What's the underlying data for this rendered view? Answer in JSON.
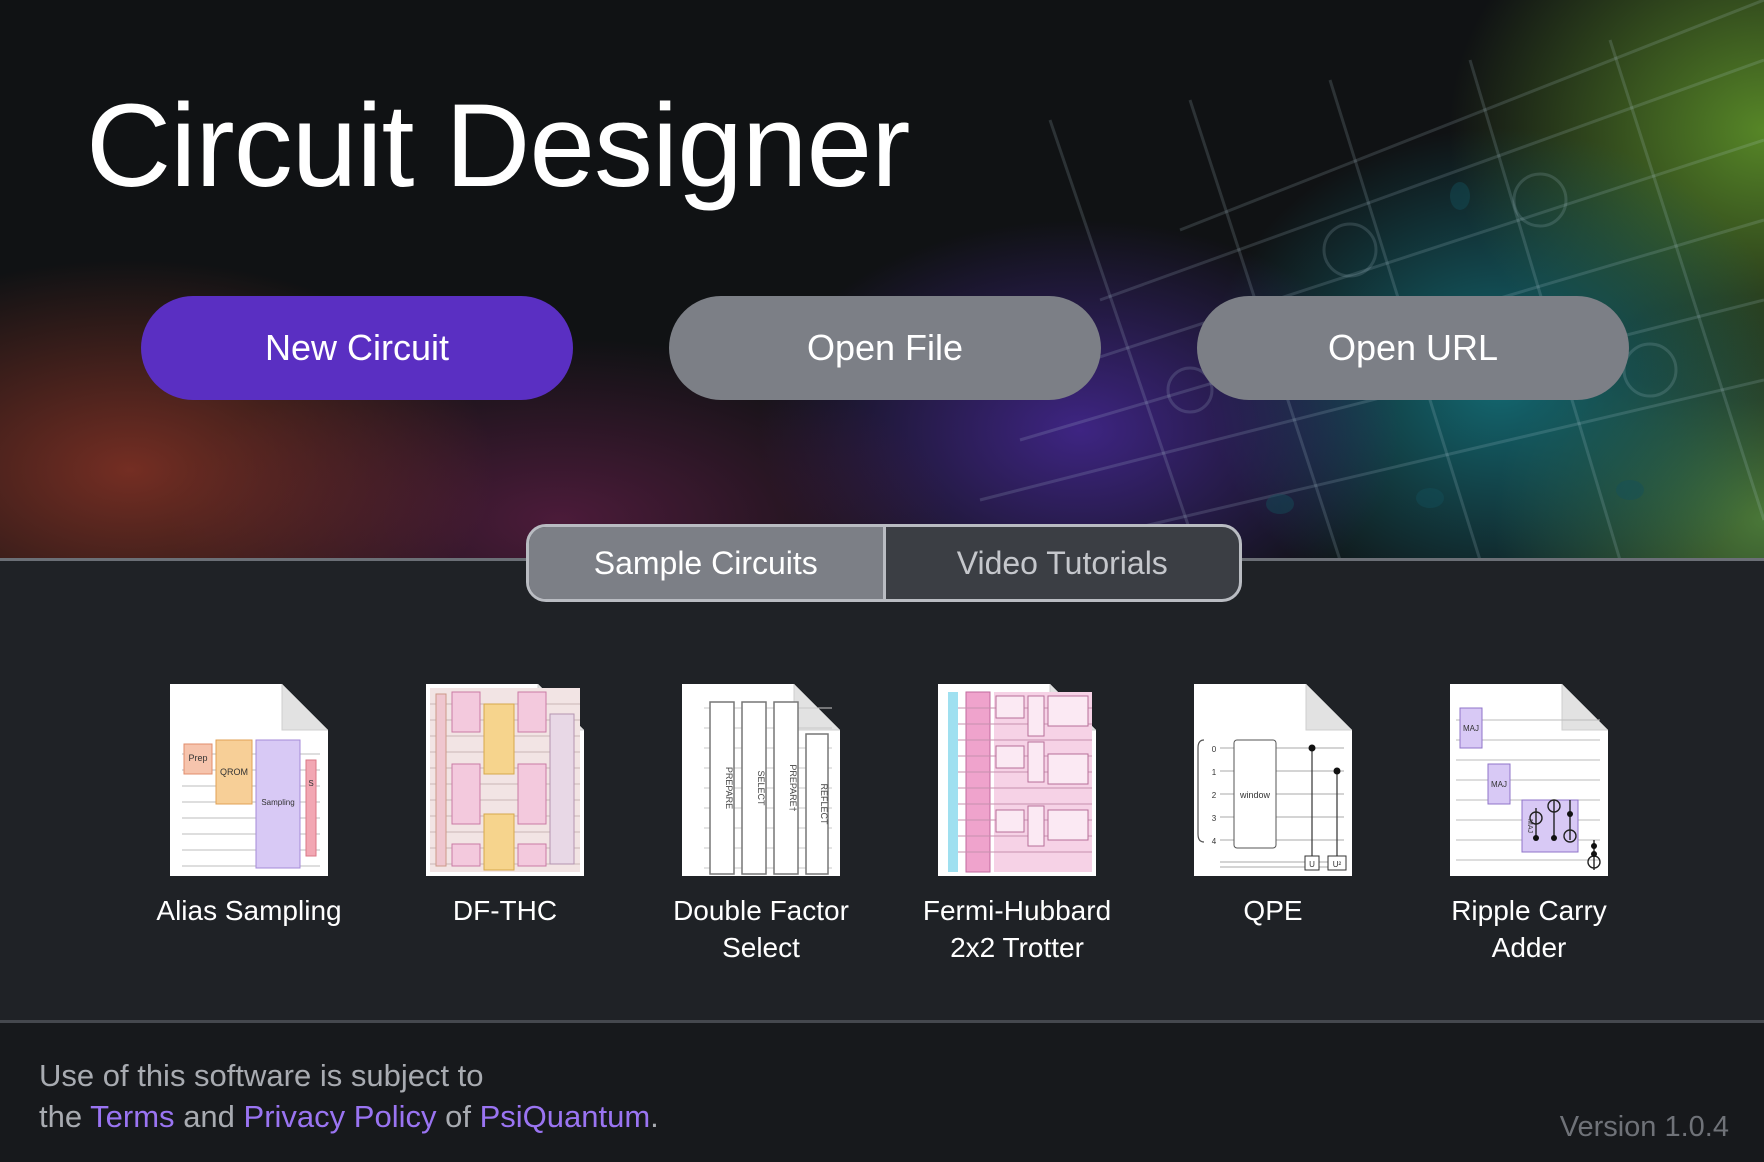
{
  "app": {
    "title": "Circuit Designer"
  },
  "actions": {
    "new_circuit": "New Circuit",
    "open_file": "Open File",
    "open_url": "Open URL"
  },
  "tabs": [
    {
      "label": "Sample Circuits",
      "active": true
    },
    {
      "label": "Video Tutorials",
      "active": false
    }
  ],
  "samples": [
    {
      "label": "Alias Sampling",
      "thumbnail": "alias-sampling-circuit-thumbnail",
      "thumb_text": [
        "Prep",
        "QROM",
        "Sampling",
        "S"
      ]
    },
    {
      "label": "DF-THC",
      "thumbnail": "df-thc-circuit-thumbnail",
      "thumb_text": []
    },
    {
      "label": "Double Factor\nSelect",
      "thumbnail": "double-factor-select-circuit-thumbnail",
      "thumb_text": [
        "PREPARE",
        "SELECT",
        "PREPARE†",
        "REFLECT"
      ]
    },
    {
      "label": "Fermi-Hubbard\n2x2 Trotter",
      "thumbnail": "fermi-hubbard-circuit-thumbnail",
      "thumb_text": []
    },
    {
      "label": "QPE",
      "thumbnail": "qpe-circuit-thumbnail",
      "thumb_text": [
        "0",
        "1",
        "2",
        "3",
        "4",
        "window",
        "U",
        "U²"
      ]
    },
    {
      "label": "Ripple Carry\nAdder",
      "thumbnail": "ripple-carry-adder-circuit-thumbnail",
      "thumb_text": [
        "MAJ",
        "MAJ",
        "MAJ"
      ]
    }
  ],
  "footer": {
    "line1": "Use of this software is subject to",
    "the": "the",
    "terms": "Terms",
    "and": "and",
    "privacy": "Privacy Policy",
    "of": "of",
    "company": "PsiQuantum",
    "period": ".",
    "version": "Version 1.0.4"
  },
  "colors": {
    "primary_button": "#5a2fc2",
    "secondary_button": "#7c7f86",
    "link": "#9a74f2",
    "background": "#1f2226"
  }
}
